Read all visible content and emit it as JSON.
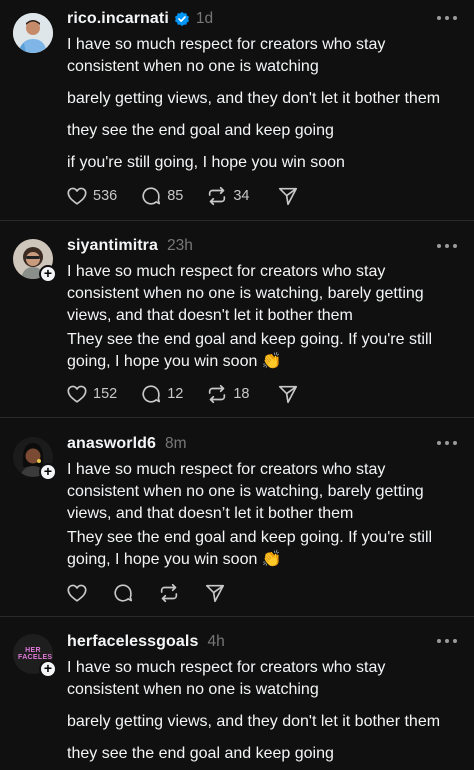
{
  "posts": [
    {
      "username": "rico.incarnati",
      "verified": true,
      "time": "1d",
      "lines": [
        "I have so much respect for creators who stay",
        "consistent when no one is watching",
        "barely getting views, and they don't let it bother them",
        "they see the end goal and keep going",
        "if you're still going, I hope you win soon"
      ],
      "likes": "536",
      "replies": "85",
      "reposts": "34"
    },
    {
      "username": "siyantimitra",
      "time": "23h",
      "lines": [
        "I have so much respect for creators who stay",
        "consistent when no one is watching, barely getting",
        "views, and that doesn't let it bother them",
        "They see the end goal and keep going. If you're still",
        "going, I hope you win soon"
      ],
      "emoji": "👏",
      "likes": "152",
      "replies": "12",
      "reposts": "18"
    },
    {
      "username": "anasworld6",
      "time": "8m",
      "lines": [
        "I have so much respect for creators who stay",
        "consistent when no one is watching, barely getting",
        "views, and that doesn’t let it bother them",
        "They see the end goal and keep going. If you're still",
        "going, I hope you win soon"
      ],
      "emoji": "👏"
    },
    {
      "username": "herfacelessgoals",
      "time": "4h",
      "avatar_text": "HER FACELESS",
      "lines": [
        "I have so much respect for creators who stay",
        "consistent when no one is watching",
        "barely getting views, and they don't let it bother them",
        "they see the end goal and keep going"
      ]
    }
  ],
  "colors": {
    "background": "#101010",
    "text": "#f3f5f7",
    "muted": "#777777",
    "verified": "#0095f6"
  }
}
